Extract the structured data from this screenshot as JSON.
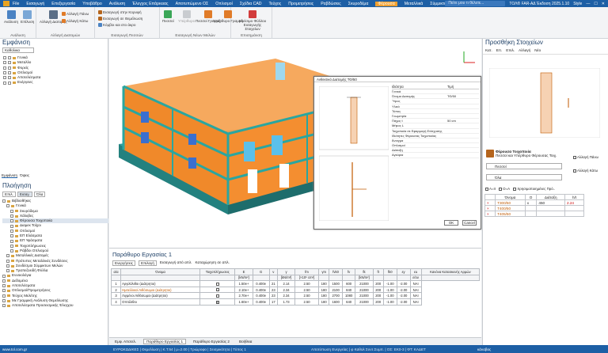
{
  "menu": {
    "items": [
      "File",
      "Εισαγωγή",
      "Επεξεργασία",
      "Υποβάθρο",
      "Ανάλυση",
      "Έλεγχος Επάρκειας",
      "Αποτυπώμενο ΟΣ",
      "Οπλισμοί",
      "Σχέδια CAD",
      "Τεύχος",
      "Προμετρήσεις",
      "Ραβδώσεις",
      "Σκυροδέμα",
      "Φέρουσα",
      "Μεταλλικά",
      "Σύμμικτα",
      "Ξύλινα"
    ],
    "active": "Φέρουσα",
    "search": "Πείτε μου τι θέλετε...",
    "product": "ΤΟΛ® FAR-ΑΔ Έκδοση 2025.1.10",
    "style": "Style"
  },
  "ribbon": {
    "groups": [
      {
        "title": "Ανάλυση",
        "buttons": [
          "Ανάλυση",
          "Επίλυση"
        ]
      },
      {
        "title": "Αλλαγή Διατομών",
        "buttons": [
          "Αλλαγή Διατομής",
          "Αλλαγή Πάνω",
          "Αλλαγή Κάτω"
        ]
      },
      {
        "title": "Εισαγωγή Πεσσών",
        "buttons": [
          "Εισαγωγή στην Κορυφή",
          "Εισαγωγή σε Θεμέλιωση",
          "Κόμβοι και στο άκρο"
        ]
      },
      {
        "title": "Εισαγωγή Νέων Μελών",
        "buttons": [
          "Πεσσοί",
          "Υπέρθυρο",
          "Πεσσοί Γραμμή",
          "Υπέρθυρο Γραμμή"
        ]
      },
      {
        "title": "Επισημάνση",
        "buttons": [
          "Κλείσιμο Φύλλου Εισαγωγής Στοιχείων"
        ]
      }
    ]
  },
  "left": {
    "display_title": "Εμφάνιση",
    "display_filter": "Καθολικα",
    "display_items": [
      "Γενικά",
      "Μεταλλο",
      "Φορείς",
      "Οπλισμοί",
      "Αποτελέσματα",
      "Ενέργειες"
    ],
    "tabs": [
      "Εμφάνιση",
      "Όψεις"
    ],
    "nav_title": "Πλοήγηση",
    "nav_tabs": [
      "Επιλ.",
      "Εισαγ.",
      "Όλα"
    ],
    "tree": [
      "Βιβλιοθήκες",
      "Γενικά",
      "Σκυρόδεμα",
      "Χάλυβες",
      "Φέρουσα Τοιχοποιία",
      "Διαμεκ Τοίχοι",
      "Οπλισμοί",
      "ΕΠ Ελάσματα",
      "ΕΠ Υφάσματα",
      "Τοιχοπλήρωσεις",
      "Ράβδοι Οπλισμού",
      "Μεταλλικές Διατομές",
      "Πρότυπες Μεταλλικές Συνδέσεις",
      "Συνδέσμοι Σύμμικτων Μελών",
      "Τραπεζοειδή Φύλλα",
      "Εννοιολόγια",
      "Δεδομένα",
      "Αποτελέσματα",
      "Οπλισμοί/Προμετρήσεις",
      "Τεύχος Μελέτης",
      "Με Γραμμική Ανάλυση Θεμελίωσης",
      "Αποτελέσματα Προσεισμικής Έλεγχου"
    ]
  },
  "dialog": {
    "title": "Ανθεκτικό Διατομής ΤΘ/50",
    "ok": "OK",
    "cancel": "Cancel",
    "props_header": [
      "Ιδιότητα",
      "Τιμή"
    ],
    "props": [
      "Γενικά",
      "Όνομα Διατομής",
      "Ύψος",
      "Υλικό",
      "Τύπος",
      "Γεωμετρία",
      "Πάχος t",
      "Μήκος L",
      "Τοιχοποιία σε Εφαρμογή Ενίσχυσης",
      "Ιδιότητες Φέρουσας Τοιχοποιίας",
      "Άνοιγμα",
      "Οπλισμοί",
      "Διάταξη",
      "Αγκύρια"
    ],
    "values": [
      "",
      "ΤΘ/50",
      "",
      "",
      "",
      "",
      "50 cm",
      "",
      "",
      "",
      "",
      "",
      "",
      ""
    ]
  },
  "workpad": {
    "title": "Παράθυρο Εργασίας 1",
    "tabs": [
      "Ενεργήσεις",
      "Επιλογή"
    ],
    "actions": [
      "Εισαγωγή από απλ.",
      "Καταχώρηση σε απλ."
    ],
    "headers": [
      "α/α",
      "Όνομα",
      "Τοιχοπλήρωσεις",
      "Ε",
      "G",
      "ν",
      "γ",
      "fm",
      "γm",
      "fvk0",
      "fv",
      "fk",
      "ft",
      "fk0",
      "εy",
      "εu",
      "Κανόνα Κατασκευής Αρμών"
    ],
    "units": [
      "",
      "",
      "",
      "[kN/m²]",
      "",
      "",
      "[kN/m³]",
      "[×10⁶ cm²]",
      "",
      "",
      "",
      "[kN/m²]",
      "",
      "",
      "",
      "ε/ου",
      ""
    ],
    "rows": [
      {
        "n": "1",
        "name": "Αργιλόλιθοι (Διάτρητοι)",
        "chk": "",
        "e": "1.50e+",
        "g": "0.400e",
        "v": "21",
        "w": "2.14",
        "fm": "2.50",
        "gm": "180",
        "a": "1500",
        "b": "600",
        "c": "21000",
        "d": "200",
        "ey": "-1.00",
        "eu": "-2.00",
        "k": "ΝΑΙ"
      },
      {
        "n": "2",
        "name": "Ημιτελλικοί Λιθόσωμοι (Διάτρητοι)",
        "chk": "",
        "e": "2.10e+",
        "g": "0.400e",
        "v": "23",
        "w": "2.34",
        "fm": "2.50",
        "gm": "180",
        "a": "2100",
        "b": "840",
        "c": "21000",
        "d": "200",
        "ey": "-1.00",
        "eu": "-2.00",
        "k": "ΝΑΙ"
      },
      {
        "n": "3",
        "name": "Λιγμένοι Λιθόσωμοι (Διάτρητοι)",
        "chk": "",
        "e": "2.70e+",
        "g": "0.400e",
        "v": "23",
        "w": "2.34",
        "fm": "2.50",
        "gm": "180",
        "a": "2700",
        "b": "1080",
        "c": "21000",
        "d": "200",
        "ey": "-1.00",
        "eu": "-2.00",
        "k": "ΝΑΙ"
      },
      {
        "n": "4",
        "name": "Οπτόλιθοι",
        "chk": "x",
        "e": "1.60e+",
        "g": "0.400e",
        "v": "17",
        "w": "1.73",
        "fm": "2.50",
        "gm": "180",
        "a": "1600",
        "b": "640",
        "c": "21000",
        "d": "200",
        "ey": "-1.00",
        "eu": "-2.00",
        "k": "ΝΑΙ"
      }
    ],
    "bottom_tabs": [
      "Εμφ. Αποτελ.",
      "Παράθυρο Εργασίας 1",
      "Παράθυρο Εργασίας 2",
      "Βοήθεια"
    ]
  },
  "right": {
    "title": "Προσθήκη Στοιχείων",
    "toolbar": [
      "Κατ.",
      "Επ.",
      "Επιλ.",
      "Αλλαγή",
      "Νέο"
    ],
    "section_title": "Φέρουσα Τοιχοποιία",
    "section_sub": "Πεσσοί και Υπέρθυρο Φέρουσας Τοιχ.",
    "type_select": "Πεσσοί",
    "all_select": "Όλα",
    "checks": [
      "Αλλαγή Πάνω",
      "Αλλαγή Κάτω"
    ],
    "options": [
      "Α=ΙΙ",
      "Ο=Α",
      "Χρησιμοποιημένες Πρό.."
    ],
    "table_headers": [
      "Όνομα",
      "Ο",
      "Διάταξη",
      "h/t"
    ],
    "table_rows": [
      {
        "name": "Τ300/50",
        "o": "x",
        "d": "450",
        "h": "2.24"
      },
      {
        "name": "Τ400/50",
        "o": "",
        "d": "",
        "h": ""
      },
      {
        "name": "Τ405/50",
        "o": "",
        "d": "",
        "h": ""
      }
    ]
  },
  "status": {
    "site": "www.tol.com.gr",
    "text": "ΕΥΡΩΚΩΔΙΚΕΣ | Θεμελίωση | Κ.Τ.54 | μ=2.00 | Τριώροφο | Σεισμικότητα | Τύπος 1",
    "right": "Αποτύπωση Ενεργείας | φ Καθολ Συντ.Συμπ. | ΟΣ: ΕΚ0-3 | ΦΤ: ΚΑΔΕΤ",
    "zoom": "κάναβος"
  },
  "colors": {
    "accent": "#1d5fa5",
    "active_tab": "#f0a030",
    "wall": "#f0892a",
    "column": "#2aa6a0"
  }
}
